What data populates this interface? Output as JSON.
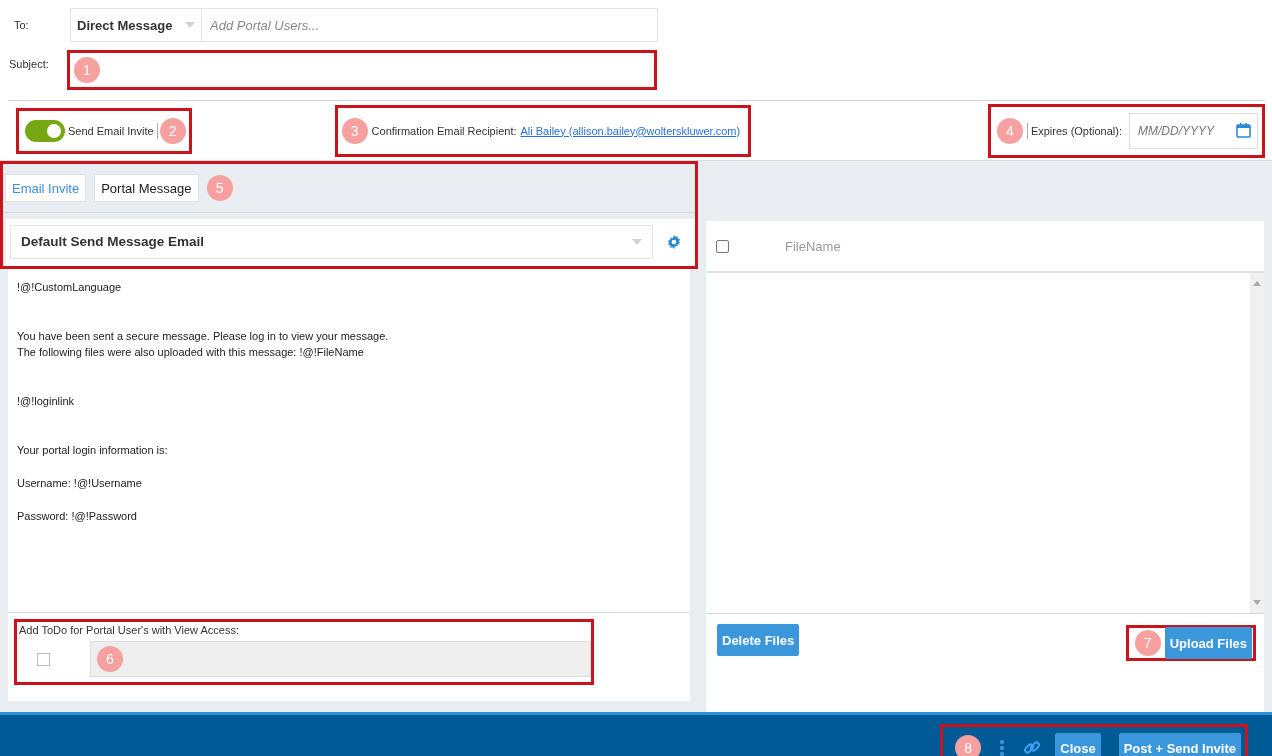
{
  "to": {
    "label": "To:",
    "type_dropdown": "Direct Message",
    "users_placeholder": "Add Portal Users..."
  },
  "subject": {
    "label": "Subject:",
    "callout": "1"
  },
  "send_email_invite": {
    "label": "Send Email Invite",
    "on": true,
    "callout": "2"
  },
  "confirmation": {
    "label": "Confirmation Email Recipient:",
    "link": "Ali Bailey (allison.bailey@wolterskluwer.com)",
    "callout": "3"
  },
  "expires": {
    "label": "Expires (Optional):",
    "placeholder": "MM/DD/YYYY",
    "callout": "4"
  },
  "tabs": [
    {
      "label": "Email Invite",
      "selected": true
    },
    {
      "label": "Portal Message",
      "selected": false
    }
  ],
  "tabs_callout": "5",
  "template": {
    "value": "Default Send Message Email"
  },
  "message_sections": [
    [
      [
        "!@!CustomLanguage"
      ]
    ],
    [
      [
        "You have been sent a secure message. Please log in to view your message.",
        "The following files were also uploaded with this message: !@!FileName"
      ]
    ],
    [
      [
        "!@!loginlink"
      ]
    ],
    [
      [
        "Your portal login information is:"
      ],
      [
        "Username: !@!Username"
      ],
      [
        "Password: !@!Password"
      ]
    ]
  ],
  "todo": {
    "label": "Add ToDo for Portal User's with View Access:",
    "checked": false,
    "callout": "6"
  },
  "files": {
    "columns": [
      "FileName"
    ],
    "header_checked": false,
    "delete_button": "Delete Files",
    "upload_button": "Upload Files",
    "upload_callout": "7"
  },
  "footer": {
    "callout": "8",
    "buttons": [
      "Close",
      "Post + Send Invite"
    ]
  }
}
